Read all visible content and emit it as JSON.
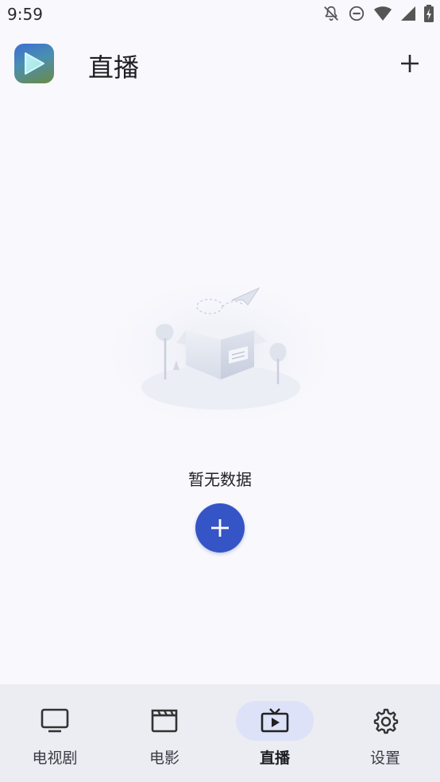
{
  "status_bar": {
    "time": "9:59",
    "icons": [
      "notifications-off-icon",
      "do-not-disturb-icon",
      "wifi-icon",
      "signal-icon",
      "battery-charging-icon"
    ]
  },
  "app_bar": {
    "logo_icon": "play-logo-icon",
    "title": "直播",
    "add_icon": "plus-icon"
  },
  "empty_state": {
    "illustration": "empty-box-illustration",
    "message": "暂无数据",
    "add_icon": "plus-icon"
  },
  "bottom_nav": {
    "items": [
      {
        "label": "电视剧",
        "icon": "monitor-icon",
        "active": false
      },
      {
        "label": "电影",
        "icon": "clapperboard-icon",
        "active": false
      },
      {
        "label": "直播",
        "icon": "live-tv-icon",
        "active": true
      },
      {
        "label": "设置",
        "icon": "settings-gear-icon",
        "active": false
      }
    ]
  },
  "colors": {
    "background": "#f8f8fd",
    "accent": "#3555c6",
    "nav_background": "#ececf3",
    "nav_active_pill": "#dde2f8"
  }
}
